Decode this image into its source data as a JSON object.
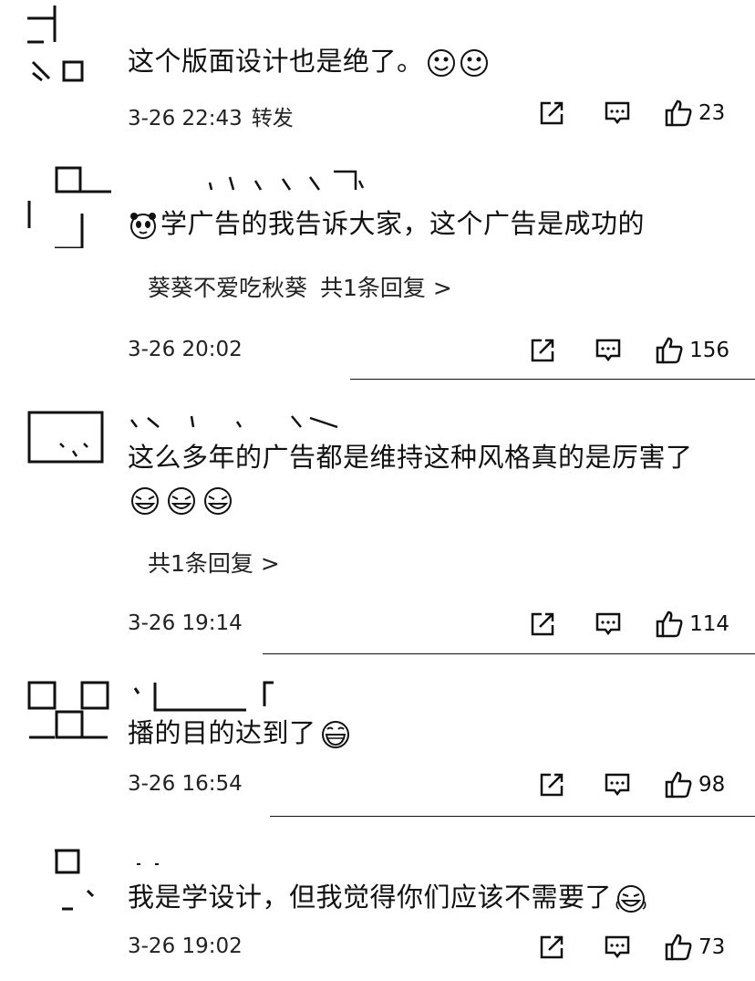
{
  "comments": [
    {
      "text": "这个版面设计也是绝了。",
      "time": "3-26 22:43",
      "forward": "转发",
      "likes": "23"
    },
    {
      "text": "学广告的我告诉大家，这个广告是成功的",
      "reply_user": "葵葵不爱吃秋葵",
      "reply_link": "共1条回复 >",
      "time": "3-26 20:02",
      "likes": "156"
    },
    {
      "text": "这么多年的广告都是维持这种风格真的是厉害了",
      "reply_link": "共1条回复 >",
      "time": "3-26 19:14",
      "likes": "114"
    },
    {
      "text": "播的目的达到了",
      "time": "3-26 16:54",
      "likes": "98"
    },
    {
      "text": "我是学设计，但我觉得你们应该不需要了",
      "time": "3-26 19:02",
      "likes": "73"
    }
  ],
  "icons": {
    "share": "share-icon",
    "comment": "comment-icon",
    "like": "thumbs-up-icon"
  }
}
